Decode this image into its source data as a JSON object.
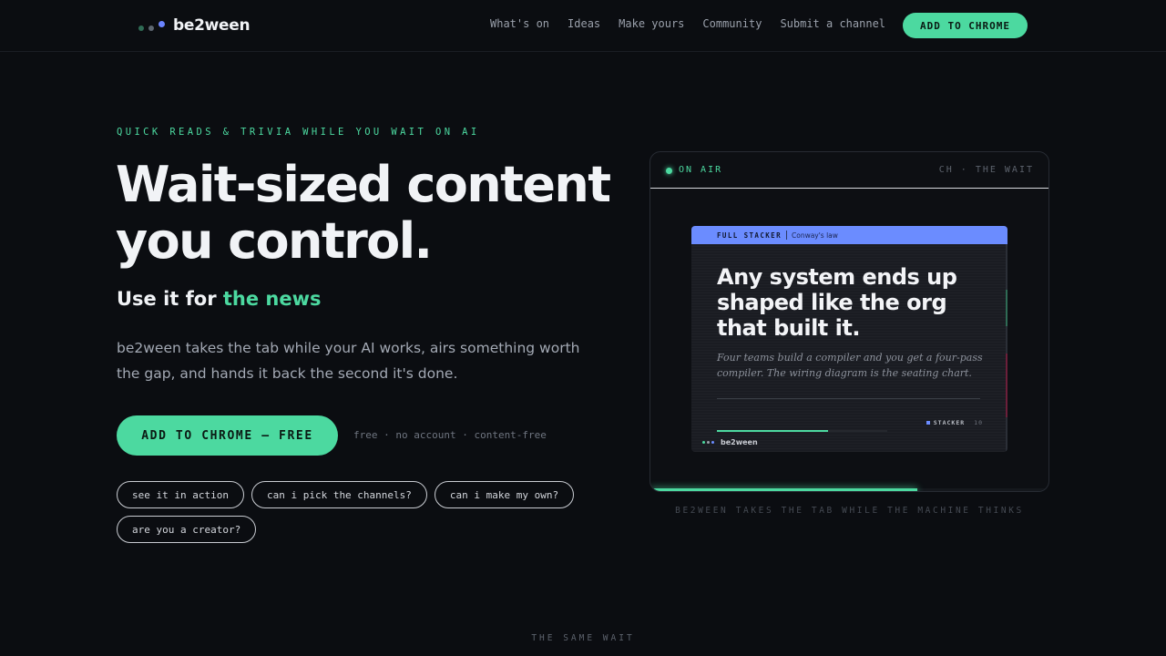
{
  "nav": {
    "brand": "be2ween",
    "links": [
      "What's on",
      "Ideas",
      "Make yours",
      "Community",
      "Submit a channel"
    ],
    "cta": "ADD TO CHROME"
  },
  "hero": {
    "eyebrow": "QUICK READS & TRIVIA WHILE YOU WAIT ON AI",
    "headline_line1": "Wait-sized content",
    "headline_line2": "you control.",
    "subhead_prefix": "Use it for",
    "subhead_accent": "the news",
    "description": "be2ween takes the tab while your AI works, airs something worth the gap, and hands it back the second it's done.",
    "cta": "ADD TO CHROME — FREE",
    "cta_note": "free · no account · content-free",
    "chips": [
      "see it in action",
      "can i pick the channels?",
      "can i make my own?",
      "are you a creator?"
    ]
  },
  "panel": {
    "status": "ON AIR",
    "channel": "CH · THE WAIT",
    "progress": 0.67,
    "card": {
      "tag": "FULL STACKER",
      "topic": "Conway's law",
      "headline": "Any system ends up shaped like the org that built it.",
      "body": "Four teams build a compiler and you get a four-pass compiler. The wiring diagram is the seating chart.",
      "source": "STACKER",
      "source_num": "10",
      "brand": "be2ween",
      "progress": 0.65
    },
    "caption": "BE2WEEN TAKES THE TAB WHILE THE MACHINE THINKS"
  },
  "next_section": {
    "label": "THE SAME WAIT"
  },
  "colors": {
    "accent": "#4cd9a0",
    "card_accent": "#6b8cff",
    "background": "#0b0d11"
  }
}
